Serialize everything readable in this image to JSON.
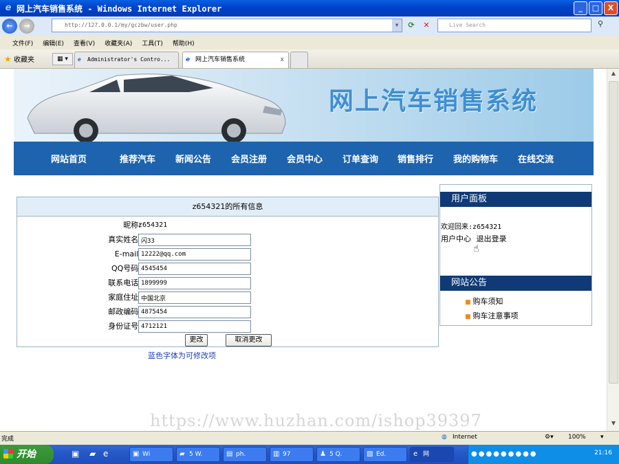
{
  "window": {
    "title": "网上汽车销售系统 - Windows Internet Explorer",
    "btn_min": "_",
    "btn_max": "□",
    "btn_close": "X"
  },
  "address": {
    "url": "http://127.0.0.1/my/gczbw/user.php",
    "search_placeholder": "Live Search"
  },
  "menu": [
    "文件(F)",
    "编辑(E)",
    "查看(V)",
    "收藏夹(A)",
    "工具(T)",
    "帮助(H)"
  ],
  "favorites_label": "收藏夹",
  "tabs": {
    "tab1": "Administrator's Contro...",
    "tab2": "网上汽车销售系统",
    "close": "x"
  },
  "site": {
    "title": "网上汽车销售系统",
    "nav": [
      "网站首页",
      "推荐汽车",
      "新闻公告",
      "会员注册",
      "会员中心",
      "订单查询",
      "销售排行",
      "我的购物车",
      "在线交流"
    ]
  },
  "info": {
    "header": "z654321的所有信息",
    "nickname_label": "昵称:",
    "nickname": "z654321",
    "fields": [
      {
        "label": "真实姓名:",
        "value": "闪33"
      },
      {
        "label": "E-mail:",
        "value": "12222@qq.com"
      },
      {
        "label": "QQ号码:",
        "value": "4545454"
      },
      {
        "label": "联系电话:",
        "value": "1899999"
      },
      {
        "label": "家庭住址:",
        "value": "中国北京"
      },
      {
        "label": "邮政编码:",
        "value": "4875454"
      },
      {
        "label": "身份证号:",
        "value": "4712121"
      }
    ],
    "submit": "更改",
    "cancel": "取消更改",
    "hint": "蓝色字体为可修改项"
  },
  "side": {
    "user_panel_title": "用户面板",
    "welcome": "欢迎回来:z654321",
    "user_center": "用户中心",
    "logout": "退出登录",
    "notice_title": "网站公告",
    "notices": [
      "购车须知",
      "购车注意事项"
    ]
  },
  "watermark": "https://www.huzhan.com/ishop39397",
  "status": {
    "left": "完成",
    "zone": "Internet",
    "zoom": "100%"
  },
  "taskbar": {
    "start": "开始",
    "tasks": [
      "Wi",
      "5 W.",
      "ph.",
      "97",
      "5 Q.",
      "Ed.",
      "网"
    ],
    "clock": "21:16"
  }
}
